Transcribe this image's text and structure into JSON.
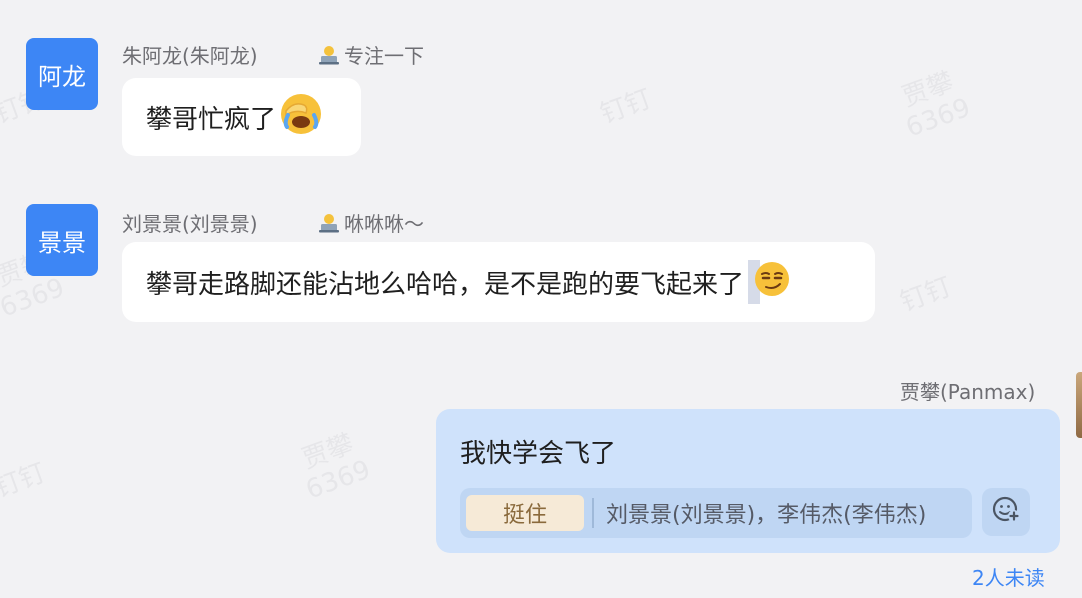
{
  "watermark": {
    "name": "贾攀",
    "code": "6369",
    "app": "钉钉"
  },
  "messages": [
    {
      "avatar_text": "阿龙",
      "sender": "朱阿龙(朱阿龙)",
      "status_text": "专注一下",
      "status_icon": "laptop-person-icon",
      "text": "攀哥忙疯了",
      "emoji": "face-palm-crying-icon"
    },
    {
      "avatar_text": "景景",
      "sender": "刘景景(刘景景)",
      "status_text": "咻咻咻～",
      "status_icon": "laptop-person-icon",
      "text": "攀哥走路脚还能沾地么哈哈，是不是跑的要飞起来了",
      "emoji": "smirk-face-icon"
    }
  ],
  "self_message": {
    "sender": "贾攀(Panmax)",
    "text": "我快学会飞了",
    "reaction_label": "挺住",
    "reaction_users": "刘景景(刘景景)，李伟杰(李伟杰)",
    "read_status": "2人未读"
  },
  "colors": {
    "background": "#f2f2f4",
    "avatar": "#3d86f5",
    "self_bubble": "#cfe2fb",
    "unread_text": "#3d86f5"
  }
}
